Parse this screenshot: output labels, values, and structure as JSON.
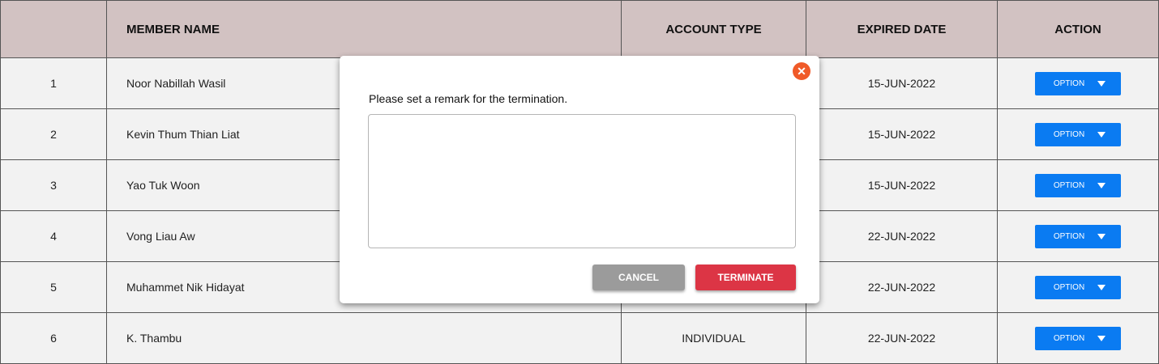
{
  "table": {
    "headers": {
      "number": "",
      "member_name": "MEMBER NAME",
      "account_type": "ACCOUNT TYPE",
      "expired_date": "EXPIRED DATE",
      "action": "ACTION"
    },
    "rows": [
      {
        "number": "1",
        "name": "Noor Nabillah Wasil",
        "account_type": "",
        "expired_date": "15-JUN-2022",
        "action_label": "OPTION"
      },
      {
        "number": "2",
        "name": "Kevin Thum Thian Liat",
        "account_type": "",
        "expired_date": "15-JUN-2022",
        "action_label": "OPTION"
      },
      {
        "number": "3",
        "name": "Yao Tuk Woon",
        "account_type": "",
        "expired_date": "15-JUN-2022",
        "action_label": "OPTION"
      },
      {
        "number": "4",
        "name": "Vong Liau Aw",
        "account_type": "",
        "expired_date": "22-JUN-2022",
        "action_label": "OPTION"
      },
      {
        "number": "5",
        "name": "Muhammet Nik Hidayat",
        "account_type": "",
        "expired_date": "22-JUN-2022",
        "action_label": "OPTION"
      },
      {
        "number": "6",
        "name": "K. Thambu",
        "account_type": "INDIVIDUAL",
        "expired_date": "22-JUN-2022",
        "action_label": "OPTION"
      }
    ]
  },
  "modal": {
    "prompt": "Please set a remark for the termination.",
    "remark_value": "",
    "cancel_label": "CANCEL",
    "terminate_label": "TERMINATE",
    "close_icon": "close-icon"
  },
  "colors": {
    "header_bg": "#d2c2c2",
    "row_bg": "#f2f2f2",
    "option_button": "#0a7bf2",
    "cancel_button": "#9b9b9b",
    "terminate_button": "#dc3545",
    "close_icon": "#f05a28"
  }
}
